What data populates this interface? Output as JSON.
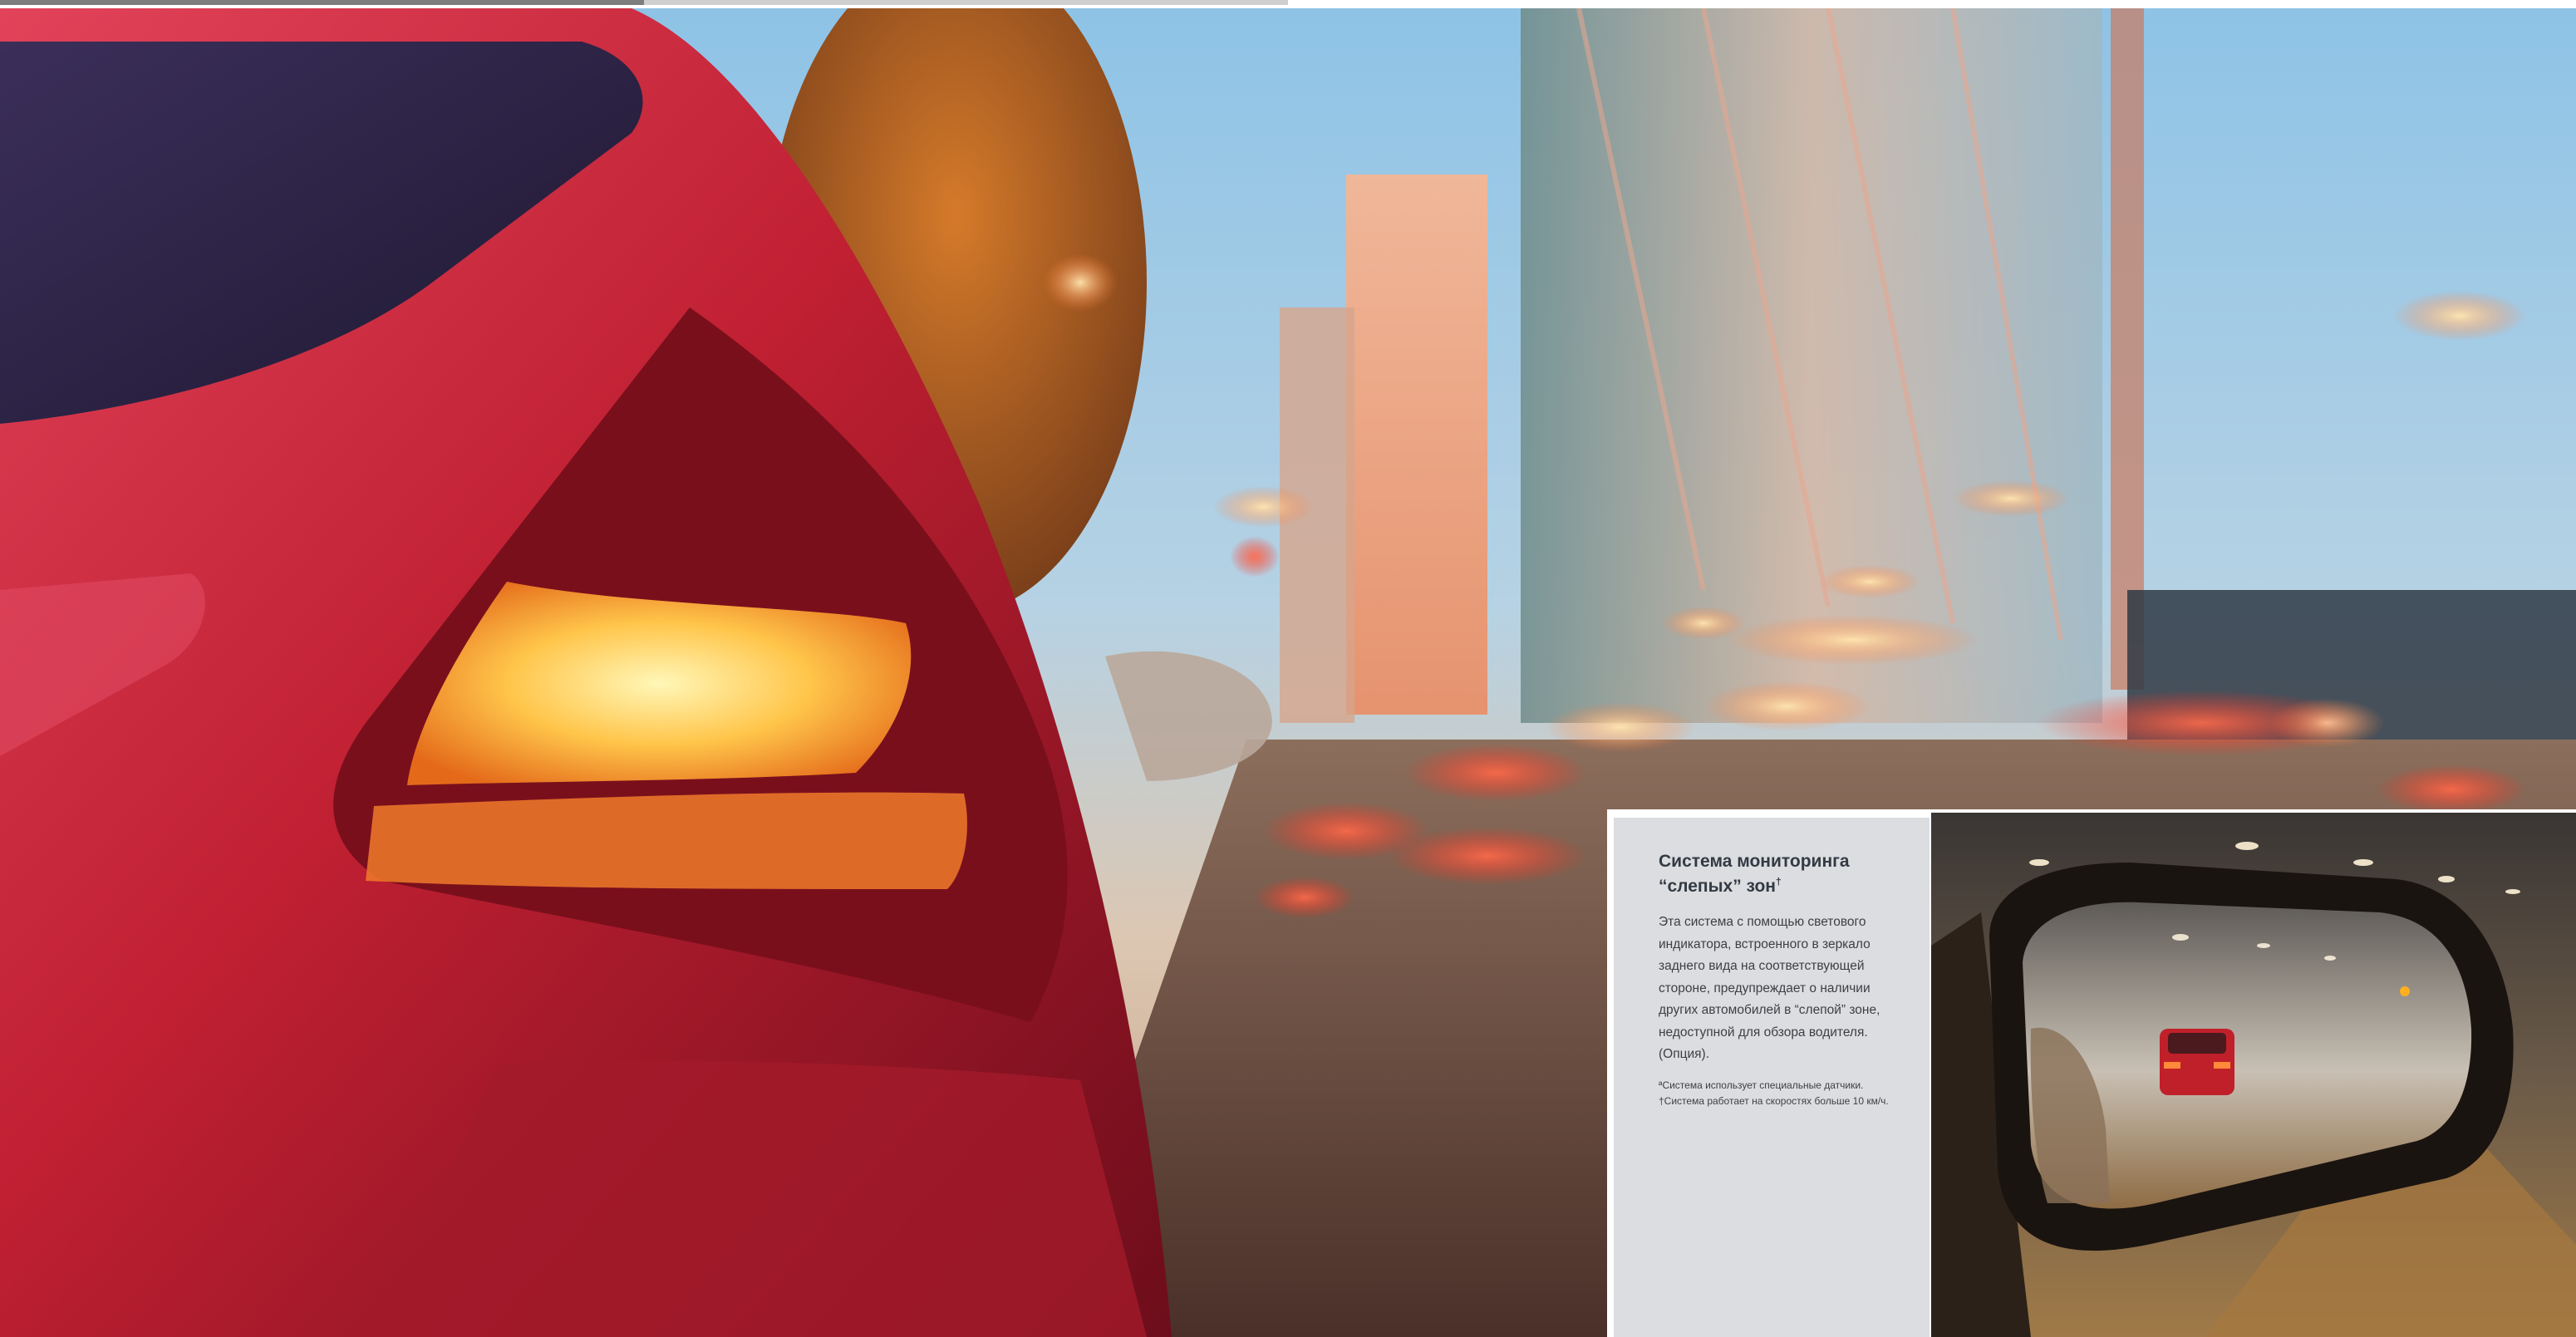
{
  "panel": {
    "title_main": "Система мониторинга",
    "title_second": "“слепых” зон",
    "title_marks": "†",
    "description": "Эта система с помощью светового индикатора, встроенного в зеркало заднего вида на соответствующей стороне, предупреждает о наличии других автомобилей в “слепой” зоне, недоступной для обзора водителя. (Опция).",
    "footnote_1": "ªСистема использует специальные датчики.",
    "footnote_2": "†Система работает на скоростях больше 10 км/ч."
  },
  "images": {
    "hero": "red-car-rear-taillight-city-street-photo",
    "inset": "side-mirror-reflecting-red-car-in-tunnel-photo"
  },
  "colors": {
    "panel_background": "#dcdde0",
    "panel_text": "#3d3f44",
    "car_red": "#b8222e",
    "taillight_amber": "#ffb43a"
  }
}
